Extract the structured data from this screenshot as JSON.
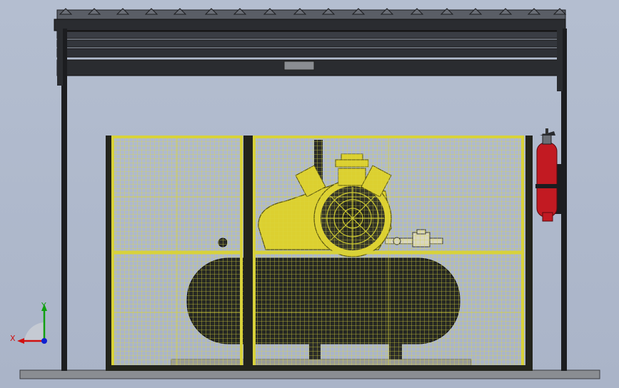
{
  "viewport": {
    "background": "#b0bacd",
    "model": "compressor-enclosure"
  },
  "colors": {
    "roof": "#2a2c30",
    "roof_fin": "#5a5e66",
    "post": "#1c1d20",
    "cage_frame": "#d8d23a",
    "cage_mesh": "#e0dc40",
    "cage_dark": "#23241c",
    "tank": "#262823",
    "compressor_body": "#dcd030",
    "extinguisher": "#c21a22",
    "floor": "#8a8d92",
    "axis_x": "#d01010",
    "axis_y": "#10a010",
    "axis_z": "#1020d0"
  },
  "triad": {
    "x_label": "X",
    "y_label": "Y",
    "icon": "view-orientation-triad-icon"
  }
}
